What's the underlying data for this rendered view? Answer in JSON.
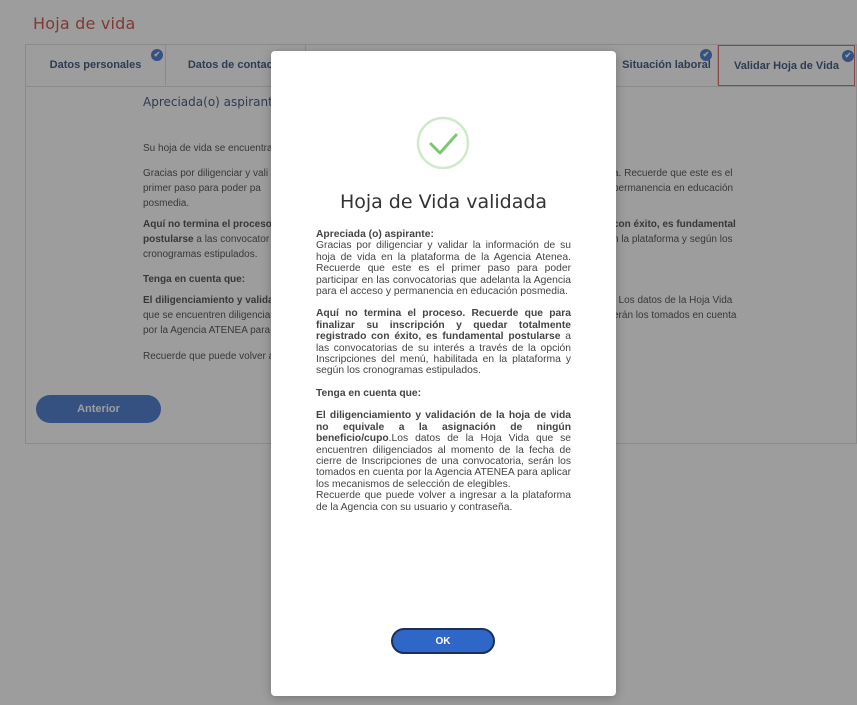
{
  "page": {
    "title": "Hoja de vida"
  },
  "tabs": [
    {
      "label": "Datos personales",
      "checked": true
    },
    {
      "label": "Datos de contacto",
      "checked": false
    },
    {
      "label": "Situación laboral",
      "checked": true
    },
    {
      "label": "Validar Hoja de Vida",
      "checked": true,
      "active": true
    }
  ],
  "content": {
    "greeting": "Apreciada(o) aspirante",
    "p1": "Su hoja de vida se encuentra",
    "p2a": "Gracias por diligenciar y vali",
    "p2b": "primer paso para poder pa",
    "p2c": "posmedia.",
    "p2_right_a": "a. Recuerde que este es el",
    "p2_right_b": "permanencia en educación",
    "p3_bold_a": "Aquí no termina el proceso.",
    "p3_bold_b": "postularse",
    "p3_rest_b": " a las convocator",
    "p3c": "cronogramas estipulados.",
    "p3_right_a": "con éxito, es fundamental",
    "p3_right_b": "n la plataforma y según los",
    "p4": "Tenga en cuenta que:",
    "p5_bold": "El diligenciamiento y validac",
    "p5b": "que se encuentren diligencia",
    "p5c": "por la Agencia ATENEA para",
    "p5_right_a": ". Los datos de la Hoja Vida",
    "p5_right_b": "erán los tomados en cuenta",
    "p6": "Recuerde que puede volver a",
    "prev_button": "Anterior"
  },
  "modal": {
    "title": "Hoja de Vida validada",
    "p1_bold": "Apreciada (o) aspirante:",
    "p1": "Gracias por diligenciar y validar la información de su hoja de vida en la plataforma de la Agencia Atenea. Recuerde que este es el primer paso para poder participar en las convocatorias que adelanta la Agencia para el acceso y permanencia en educación posmedia.",
    "p2_bold": "Aquí no termina el proceso. Recuerde que para finalizar su inscripción y quedar totalmente registrado con éxito, es fundamental postularse",
    "p2": " a las convocatorias de su interés a través de la opción Inscripciones del menú, habilitada en la plataforma y según los cronogramas estipulados.",
    "p3_bold": "Tenga en cuenta que:",
    "p4_bold": "El diligenciamiento y validación de la hoja de vida no equivale a la asignación de ningún beneficio/cupo",
    "p4": ".Los datos de la Hoja Vida que se encuentren diligenciados al momento de la fecha de cierre de Inscripciones de una convocatoria, serán los tomados en cuenta por la Agencia ATENEA para aplicar los mecanismos de selección de elegibles.",
    "p5": "Recuerde que puede volver a ingresar a la plataforma de la Agencia con su usuario y contraseña.",
    "ok_button": "OK"
  },
  "colors": {
    "accent": "#2f67c9",
    "title": "#c0392b",
    "success": "#7bc96f",
    "active_tab_border": "#d9534f"
  }
}
